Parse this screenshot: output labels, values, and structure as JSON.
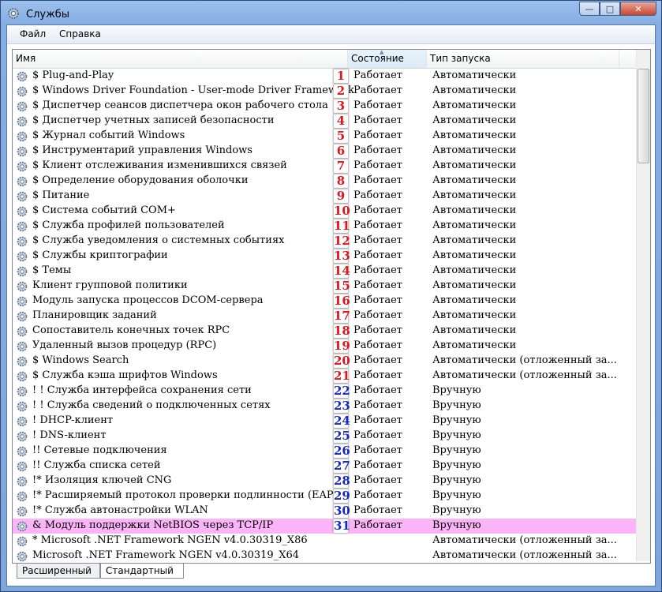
{
  "window": {
    "title": "Службы",
    "icon": "gear-icon",
    "min": "—",
    "max": "□",
    "close": "✕"
  },
  "menu": {
    "items": [
      "Файл",
      "Справка"
    ]
  },
  "columns": {
    "name": "Имя",
    "status": "Состояние",
    "startup": "Тип запуска"
  },
  "colors": {
    "highlight": "#fcb4f8",
    "badge_red": "#e0141b",
    "badge_blue": "#1429c4"
  },
  "rows": [
    {
      "name": "$ Plug-and-Play",
      "badge": "1",
      "badge_color": "red",
      "status": "Работает",
      "startup": "Автоматически"
    },
    {
      "name": "$ Windows Driver Foundation - User-mode Driver Framework",
      "badge": "2",
      "badge_color": "red",
      "status": "Работает",
      "startup": "Автоматически"
    },
    {
      "name": "$ Диспетчер сеансов диспетчера окон рабочего стола",
      "badge": "3",
      "badge_color": "red",
      "status": "Работает",
      "startup": "Автоматически"
    },
    {
      "name": "$ Диспетчер учетных записей безопасности",
      "badge": "4",
      "badge_color": "red",
      "status": "Работает",
      "startup": "Автоматически"
    },
    {
      "name": "$ Журнал событий Windows",
      "badge": "5",
      "badge_color": "red",
      "status": "Работает",
      "startup": "Автоматически"
    },
    {
      "name": "$ Инструментарий управления Windows",
      "badge": "6",
      "badge_color": "red",
      "status": "Работает",
      "startup": "Автоматически"
    },
    {
      "name": "$ Клиент отслеживания изменившихся связей",
      "badge": "7",
      "badge_color": "red",
      "status": "Работает",
      "startup": "Автоматически"
    },
    {
      "name": "$ Определение оборудования оболочки",
      "badge": "8",
      "badge_color": "red",
      "status": "Работает",
      "startup": "Автоматически"
    },
    {
      "name": "$ Питание",
      "badge": "9",
      "badge_color": "red",
      "status": "Работает",
      "startup": "Автоматически"
    },
    {
      "name": "$ Система событий COM+",
      "badge": "10",
      "badge_color": "red",
      "status": "Работает",
      "startup": "Автоматически"
    },
    {
      "name": "$ Служба профилей пользователей",
      "badge": "11",
      "badge_color": "red",
      "status": "Работает",
      "startup": "Автоматически"
    },
    {
      "name": "$ Служба уведомления о системных событиях",
      "badge": "12",
      "badge_color": "red",
      "status": "Работает",
      "startup": "Автоматически"
    },
    {
      "name": "$ Службы криптографии",
      "badge": "13",
      "badge_color": "red",
      "status": "Работает",
      "startup": "Автоматически"
    },
    {
      "name": "$ Темы",
      "badge": "14",
      "badge_color": "red",
      "status": "Работает",
      "startup": "Автоматически"
    },
    {
      "name": "Клиент групповой политики",
      "badge": "15",
      "badge_color": "red",
      "status": "Работает",
      "startup": "Автоматически"
    },
    {
      "name": "Модуль запуска процессов DCOM-сервера",
      "badge": "16",
      "badge_color": "red",
      "status": "Работает",
      "startup": "Автоматически"
    },
    {
      "name": "Планировщик заданий",
      "badge": "17",
      "badge_color": "red",
      "status": "Работает",
      "startup": "Автоматически"
    },
    {
      "name": "Сопоставитель конечных точек RPC",
      "badge": "18",
      "badge_color": "red",
      "status": "Работает",
      "startup": "Автоматически"
    },
    {
      "name": "Удаленный вызов процедур (RPC)",
      "badge": "19",
      "badge_color": "red",
      "status": "Работает",
      "startup": "Автоматически"
    },
    {
      "name": "$ Windows Search",
      "badge": "20",
      "badge_color": "red",
      "status": "Работает",
      "startup": "Автоматически (отложенный за..."
    },
    {
      "name": "$ Служба кэша шрифтов Windows",
      "badge": "21",
      "badge_color": "red",
      "status": "Работает",
      "startup": "Автоматически (отложенный за..."
    },
    {
      "name": "! ! Служба интерфейса сохранения сети",
      "badge": "22",
      "badge_color": "blue",
      "status": "Работает",
      "startup": "Вручную"
    },
    {
      "name": "! ! Служба сведений о подключенных сетях",
      "badge": "23",
      "badge_color": "blue",
      "status": "Работает",
      "startup": "Вручную"
    },
    {
      "name": "! DHCP-клиент",
      "badge": "24",
      "badge_color": "blue",
      "status": "Работает",
      "startup": "Вручную"
    },
    {
      "name": "! DNS-клиент",
      "badge": "25",
      "badge_color": "blue",
      "status": "Работает",
      "startup": "Вручную"
    },
    {
      "name": "!! Сетевые подключения",
      "badge": "26",
      "badge_color": "blue",
      "status": "Работает",
      "startup": "Вручную"
    },
    {
      "name": "!! Служба списка сетей",
      "badge": "27",
      "badge_color": "blue",
      "status": "Работает",
      "startup": "Вручную"
    },
    {
      "name": "!* Изоляция ключей CNG",
      "badge": "28",
      "badge_color": "blue",
      "status": "Работает",
      "startup": "Вручную"
    },
    {
      "name": "!* Расширяемый протокол проверки подлинности (EAP)",
      "badge": "29",
      "badge_color": "blue",
      "status": "Работает",
      "startup": "Вручную"
    },
    {
      "name": "!* Служба автонастройки WLAN",
      "badge": "30",
      "badge_color": "blue",
      "status": "Работает",
      "startup": "Вручную"
    },
    {
      "name": "& Модуль поддержки NetBIOS через TCP/IP",
      "badge": "31",
      "badge_color": "blue",
      "status": "Работает",
      "startup": "Вручную",
      "highlight": true
    },
    {
      "name": "* Microsoft .NET Framework NGEN v4.0.30319_X86",
      "badge": "",
      "badge_color": "",
      "status": "",
      "startup": "Автоматически (отложенный за..."
    },
    {
      "name": "Microsoft .NET Framework NGEN v4.0.30319_X64",
      "badge": "",
      "badge_color": "",
      "status": "",
      "startup": "Автоматически (отложенный за..."
    }
  ],
  "tabs": [
    "Расширенный",
    "Стандартный"
  ],
  "active_tab": "Стандартный"
}
